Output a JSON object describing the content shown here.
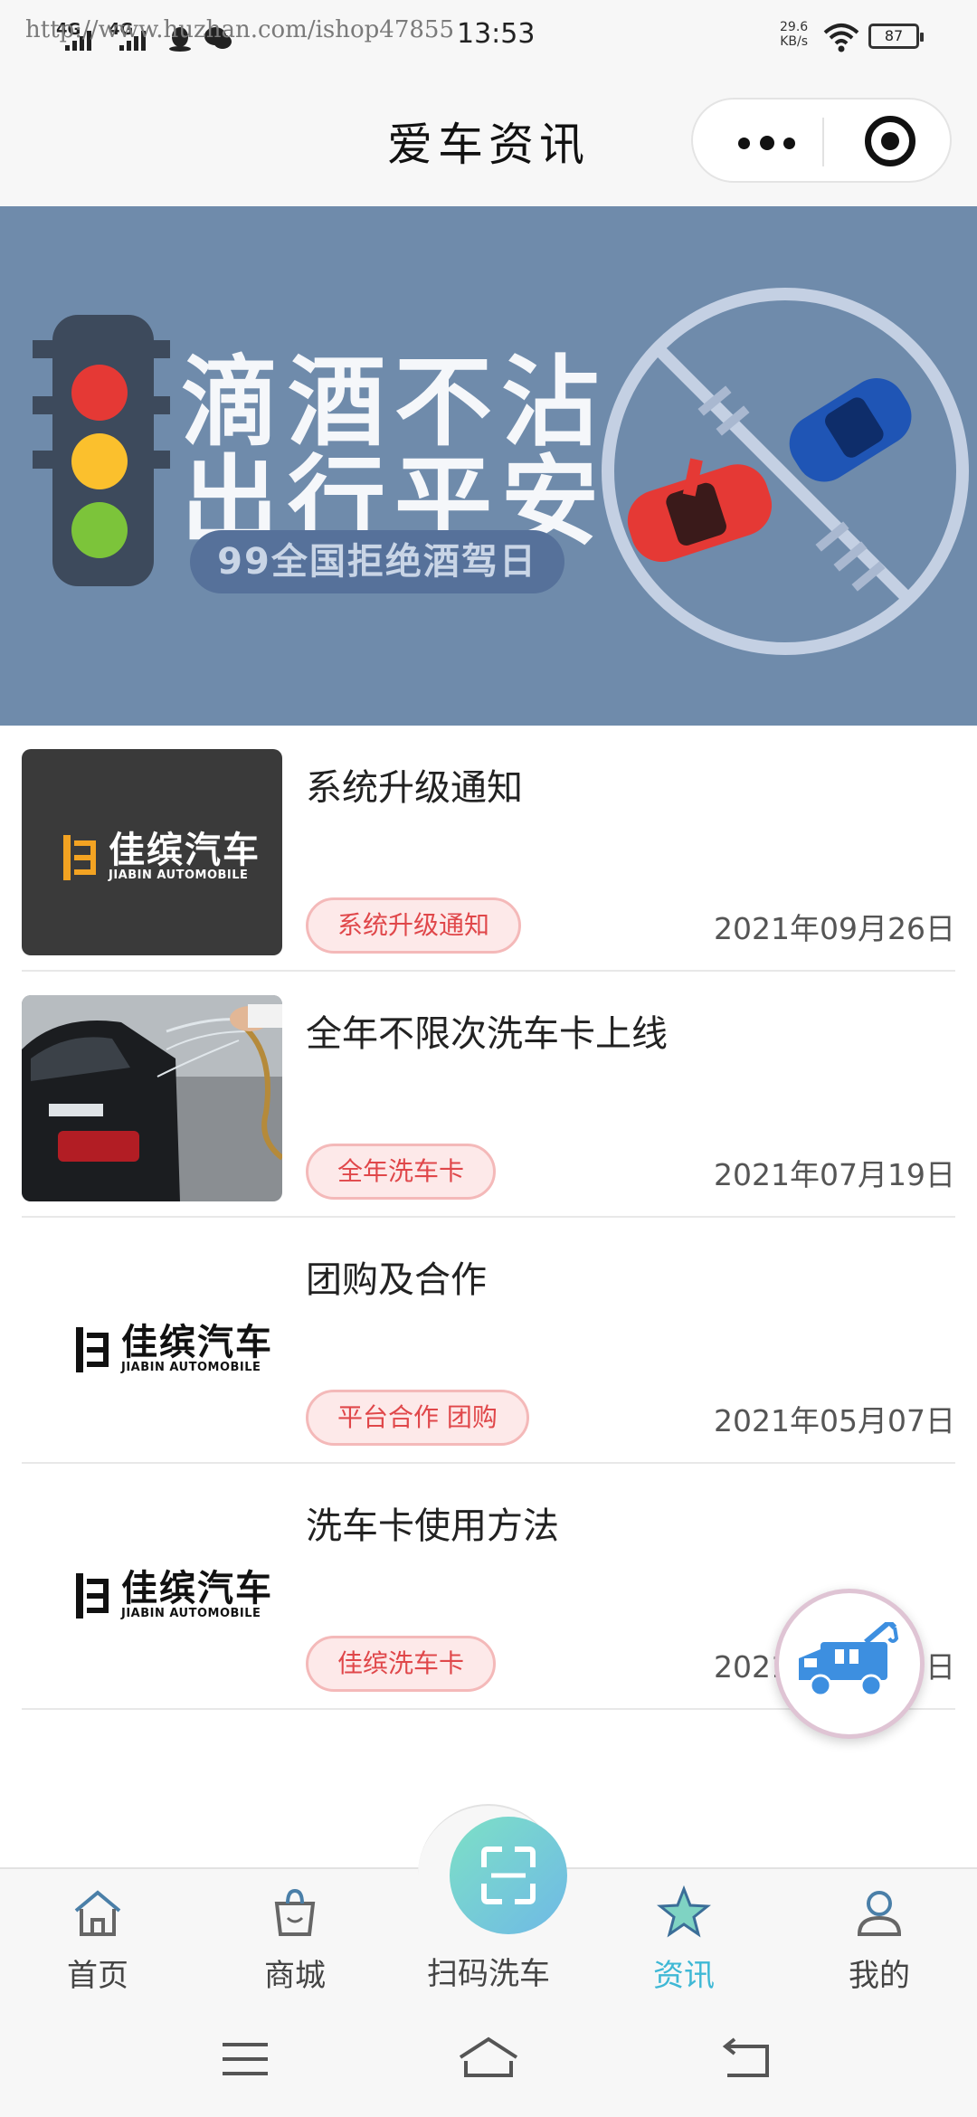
{
  "status_bar": {
    "signal1": "4G",
    "signal2": "4G",
    "watermark": "http://www.huzhan.com/ishop47855",
    "time": "13:53",
    "net_speed_value": "29.6",
    "net_speed_unit": "KB/s",
    "battery": "87"
  },
  "nav": {
    "title": "爱车资讯"
  },
  "banner": {
    "line1": "滴酒不沾",
    "line2": "出行平安",
    "pill": "99全国拒绝酒驾日"
  },
  "news": [
    {
      "title": "系统升级通知",
      "tag": "系统升级通知",
      "date": "2021年09月26日",
      "thumb": "jiabin-logo-dark",
      "logo_cn": "佳缤汽车",
      "logo_en": "JIABIN AUTOMOBILE"
    },
    {
      "title": "全年不限次洗车卡上线",
      "tag": "全年洗车卡",
      "date": "2021年07月19日",
      "thumb": "car-wash-photo"
    },
    {
      "title": "团购及合作",
      "tag": "平台合作 团购",
      "date": "2021年05月07日",
      "thumb": "jiabin-logo-white",
      "logo_cn": "佳缤汽车",
      "logo_en": "JIABIN AUTOMOBILE"
    },
    {
      "title": "洗车卡使用方法",
      "tag": "佳缤洗车卡",
      "date": "2021年05月07日",
      "thumb": "jiabin-logo-white",
      "logo_cn": "佳缤汽车",
      "logo_en": "JIABIN AUTOMOBILE"
    }
  ],
  "fab": {
    "icon": "tow-truck-icon"
  },
  "tabbar": {
    "tabs": [
      {
        "label": "首页",
        "icon": "home-icon"
      },
      {
        "label": "商城",
        "icon": "shopping-bag-icon"
      },
      {
        "label": "扫码洗车",
        "icon": "scan-icon"
      },
      {
        "label": "资讯",
        "icon": "star-icon",
        "active": true
      },
      {
        "label": "我的",
        "icon": "user-icon"
      }
    ],
    "active_color": "#3fb8d5"
  },
  "system_nav": {
    "buttons": [
      "menu-icon",
      "home-outline-icon",
      "back-icon"
    ]
  },
  "colors": {
    "banner_bg": "#6f8bab",
    "tag_text": "#e0474a",
    "tag_bg": "#fde9e9",
    "accent": "#3fb8d5"
  }
}
